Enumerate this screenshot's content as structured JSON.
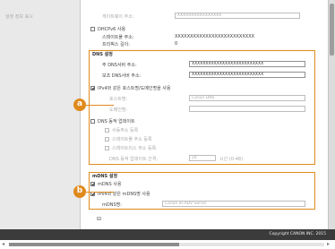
{
  "sidebar": {
    "item": "설정 정보 표시"
  },
  "ipv4": {
    "gateway_label": "게이트웨이 주소:",
    "gateway_value": "XXXXXXXXXXXXXXXX",
    "dhcp_label": "DHCPv6 사용",
    "stateless_label": "스테이트풀 주소:",
    "stateless_value": "XXXXXXXXXXXXXXXXXXXXXXXXXX",
    "prefix_label": "프리픽스 길이:",
    "prefix_value": "0"
  },
  "dns": {
    "title": "DNS 설정",
    "primary_label": "주 DNS서버 주소:",
    "primary_value": "XXXXXXXXXXXXXXXXXXXXXXXXXX",
    "secondary_label": "보조 DNS서버 주소:",
    "secondary_value": "XXXXXXXXXXXXXXXXXXXXXXXXXX",
    "same_host_label": "IPv4와 같은 호스트명/도메인명을 사용",
    "host_label": "호스트명:",
    "host_value": "Canon DNS",
    "domain_label": "도메인명:",
    "ddns_label": "DNS 동적 업데이트",
    "manual_label": "수동주소 등록",
    "stateful_reg_label": "스테이트풀 주소 등록",
    "stateless_reg_label": "스테이트리스 주소 등록",
    "interval_label": "DNS 동적 업데이트 간격:",
    "interval_value": "24",
    "interval_unit": "시간 (0-48)"
  },
  "mdns": {
    "title": "mDNS 설정",
    "use_label": "mDNS 사용",
    "same_name_label": "IPv4와 같은 mDNS명 사용",
    "name_label": "mDNS명:",
    "name_value": "Canon iR-ADV Series"
  },
  "bottom_icon": "collapse-icon",
  "badges": {
    "a": "a",
    "b": "b"
  },
  "footer": {
    "copyright": "Copyright CANON INC. 2015"
  },
  "colors": {
    "accent": "#e08a1e",
    "footer_bg": "#3b3b3b"
  }
}
